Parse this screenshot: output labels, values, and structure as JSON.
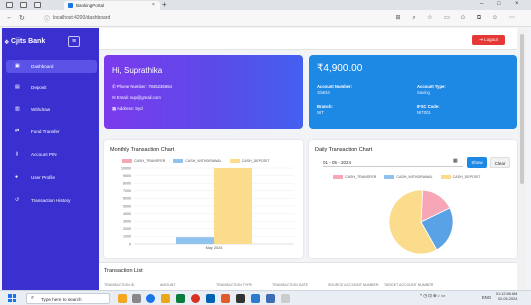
{
  "browser": {
    "tab_title": "BankingPortal",
    "url": "localhost:4200/dashboard"
  },
  "sidebar": {
    "brand": "Cjits Bank",
    "items": [
      {
        "label": "Dashboard",
        "icon": "dashboard-icon"
      },
      {
        "label": "Deposit",
        "icon": "deposit-icon"
      },
      {
        "label": "Withdraw",
        "icon": "withdraw-icon"
      },
      {
        "label": "Fund Transfer",
        "icon": "transfer-icon"
      },
      {
        "label": "Account PIN",
        "icon": "key-icon"
      },
      {
        "label": "User Profile",
        "icon": "user-icon"
      },
      {
        "label": "Transaction History",
        "icon": "history-icon"
      }
    ]
  },
  "header": {
    "logout_label": "Logout"
  },
  "user_card": {
    "greeting": "Hi, Suprathika",
    "phone": "Phone Number: 7845236654",
    "email": "Email: sup@gmail.com",
    "address": "Address: Syd"
  },
  "balance_card": {
    "amount": "₹4,900.00",
    "account_number_label": "Account Number:",
    "account_number": "1fa634",
    "account_type_label": "Account Type:",
    "account_type": "Saving",
    "branch_label": "Branch:",
    "branch": "NIT",
    "ifsc_label": "IFSC Code:",
    "ifsc": "NIT001"
  },
  "monthly_chart": {
    "title": "Monthly Transaction Chart"
  },
  "daily_chart": {
    "title": "Daily Transaction Chart",
    "date_value": "01 - 05 - 2024",
    "show_label": "Show",
    "clear_label": "Clear"
  },
  "transactions": {
    "title": "Transaction List",
    "columns": [
      "TRANSACTION ID",
      "AMOUNT",
      "TRANSACTION TYPE",
      "TRANSACTION DATE",
      "SOURCE ACCOUNT NUMBER",
      "TARGET ACCOUNT NUMBER"
    ]
  },
  "taskbar": {
    "search_placeholder": "Type here to search",
    "lang": "ENG",
    "time": "01:12:58 AM",
    "date": "02-05-2024"
  },
  "chart_data": [
    {
      "type": "bar",
      "categories": [
        "May 2024"
      ],
      "series": [
        {
          "name": "CASH_TRANSFER",
          "color": "#f7a6b5",
          "values": [
            0
          ]
        },
        {
          "name": "CASH_WITHDRAWAL",
          "color": "#8fc3ee",
          "values": [
            900
          ]
        },
        {
          "name": "CASH_DEPOSIT",
          "color": "#fbdc8c",
          "values": [
            10000
          ]
        }
      ],
      "title": "Monthly Transaction Chart",
      "ylim": [
        0,
        10000
      ],
      "yticks": [
        0,
        1000,
        2000,
        3000,
        4000,
        5000,
        6000,
        7000,
        8000,
        9000,
        10000
      ],
      "legend": "top"
    },
    {
      "type": "pie",
      "title": "Daily Transaction Chart",
      "slices": [
        {
          "label": "CASH_TRANSFER",
          "color": "#f7a6b5",
          "value": 17
        },
        {
          "label": "CASH_WITHDRAWAL",
          "color": "#5aa2e6",
          "value": 24
        },
        {
          "label": "CASH_DEPOSIT",
          "color": "#fbdc8c",
          "value": 59
        }
      ],
      "legend": "top"
    }
  ]
}
